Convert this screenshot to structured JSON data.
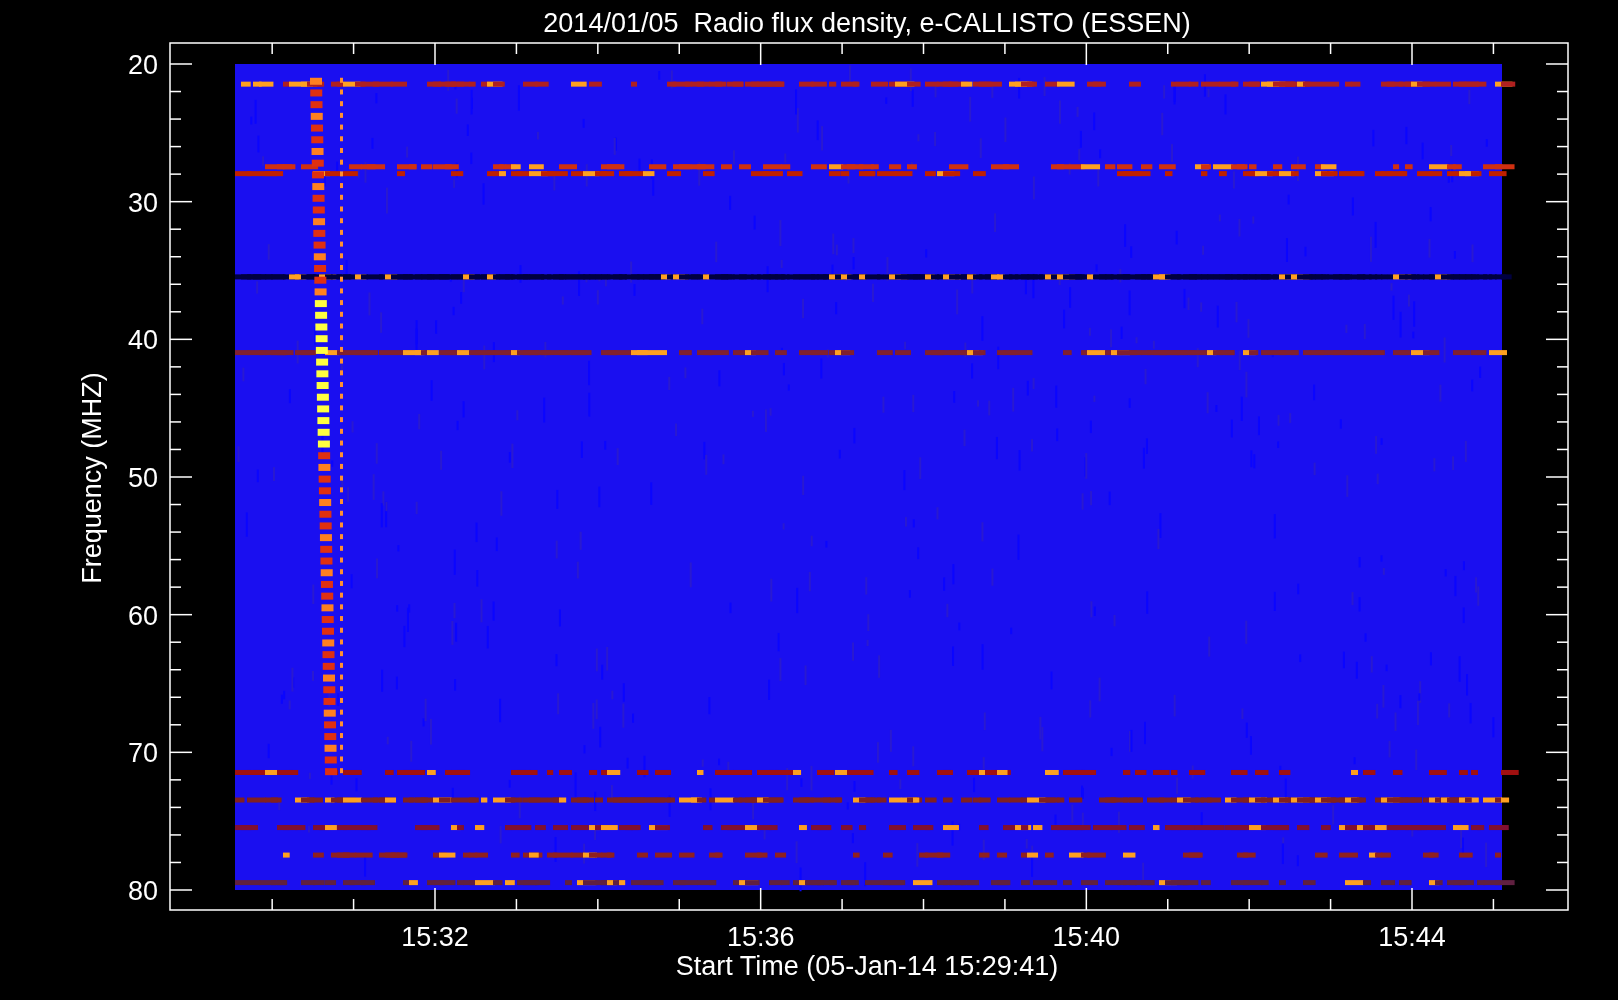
{
  "title": "2014/01/05  Radio flux density, e-CALLISTO (ESSEN)",
  "y_axis": {
    "label": "Frequency (MHZ)",
    "ticks": [
      "20",
      "30",
      "40",
      "50",
      "60",
      "70",
      "80"
    ]
  },
  "x_axis": {
    "label": "Start Time (05-Jan-14 15:29:41)",
    "ticks": [
      "15:32",
      "15:36",
      "15:40",
      "15:44"
    ]
  }
}
